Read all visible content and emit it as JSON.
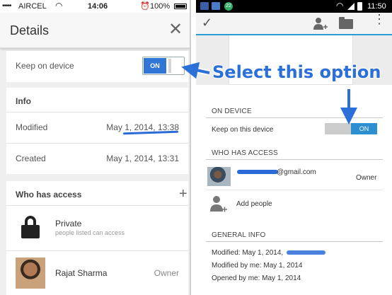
{
  "left_panel": {
    "status_bar": {
      "carrier": "AIRCEL",
      "time": "14:06",
      "battery": "100%"
    },
    "header": {
      "title": "Details",
      "close_glyph": "✕"
    },
    "keep_on_device": {
      "label": "Keep on device",
      "toggle_state": "ON"
    },
    "info": {
      "heading": "Info",
      "rows": [
        {
          "label": "Modified",
          "value": "May 1, 2014, 13:38"
        },
        {
          "label": "Created",
          "value": "May 1, 2014, 13:31"
        }
      ]
    },
    "who_has_access": {
      "heading": "Who has access",
      "add_glyph": "+",
      "private": {
        "title": "Private",
        "subtitle": "people listed can access"
      },
      "person": {
        "name": "Rajat Sharma",
        "role": "Owner"
      }
    }
  },
  "right_panel": {
    "status_bar": {
      "notification_count": "22",
      "time": "11:50"
    },
    "toolbar": {
      "check_glyph": "✓",
      "menu_glyph": "⋮"
    },
    "on_device": {
      "heading": "ON DEVICE",
      "label": "Keep on this device",
      "toggle_state": "ON"
    },
    "who_has_access": {
      "heading": "WHO HAS ACCESS",
      "email_suffix": "@gmail.com",
      "role": "Owner",
      "add_people": "Add people"
    },
    "general_info": {
      "heading": "GENERAL INFO",
      "modified": "Modified: May 1, 2014,",
      "modified_by_me": "Modified by me: May 1, 2014",
      "opened_by_me": "Opened by me: May 1, 2014"
    }
  },
  "annotation": {
    "callout": "Select this option",
    "color": "#2a70d8"
  },
  "colors": {
    "ios_toggle": "#2f76d6",
    "android_accent": "#2b9bd6",
    "android_toggle": "#2b8fd0"
  }
}
